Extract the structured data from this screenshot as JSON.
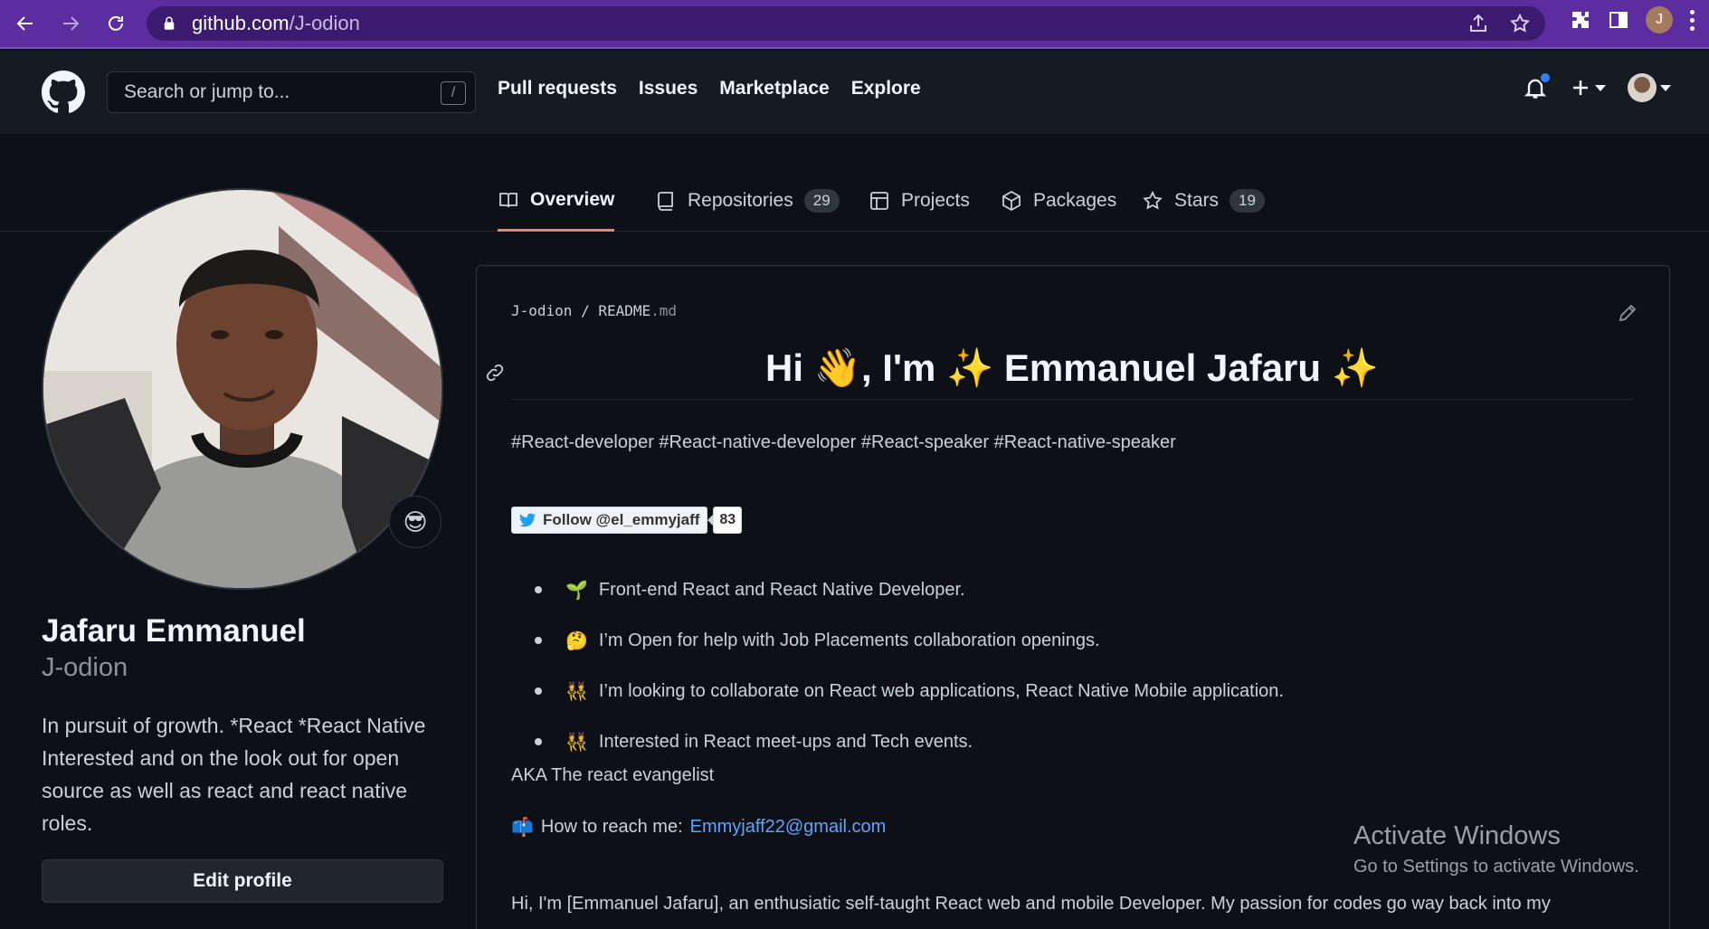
{
  "browser": {
    "url_host": "github.com",
    "url_path": "/J-odion",
    "profile_initial": "J"
  },
  "header": {
    "search_placeholder": "Search or jump to...",
    "search_shortcut": "/",
    "nav": [
      "Pull requests",
      "Issues",
      "Marketplace",
      "Explore"
    ]
  },
  "tabs": {
    "overview": "Overview",
    "repositories": "Repositories",
    "repositories_count": "29",
    "projects": "Projects",
    "packages": "Packages",
    "stars": "Stars",
    "stars_count": "19"
  },
  "profile": {
    "status_emoji": "😎",
    "name": "Jafaru Emmanuel",
    "login": "J-odion",
    "bio": "In pursuit of growth. *React *React Native Interested and on the look out for open source as well as react and react native roles.",
    "edit_button": "Edit profile"
  },
  "readme": {
    "owner": "J-odion",
    "separator": "/",
    "file_name": "README",
    "file_ext": ".md",
    "heading": "Hi 👋, I'm ✨ Emmanuel Jafaru ✨",
    "tags": "#React-developer #React-native-developer #React-speaker #React-native-speaker",
    "twitter_follow": "Follow @el_emmyjaff",
    "twitter_count": "83",
    "bullets": [
      {
        "emoji": "🌱",
        "text": "Front-end React and React Native Developer."
      },
      {
        "emoji": "🤔",
        "text": "I’m Open for help with Job Placements collaboration openings."
      },
      {
        "emoji": "👯",
        "text": "I’m looking to collaborate on React web applications, React Native Mobile application."
      },
      {
        "emoji": "👯",
        "text": "Interested in React meet-ups and Tech events."
      }
    ],
    "aka": "AKA The react evangelist",
    "reach_emoji": "📫",
    "reach_label": "How to reach me:",
    "email": "Emmyjaff22@gmail.com",
    "intro": "Hi, I'm [Emmanuel Jafaru], an enthusiatic self-taught React web and mobile Developer. My passion for codes go way back into my"
  },
  "watermark": {
    "title": "Activate Windows",
    "subtitle": "Go to Settings to activate Windows."
  },
  "colors": {
    "chrome": "#5b2d9e",
    "page_bg": "#0d1117",
    "header_bg": "#161b22",
    "tab_underline": "#f78166",
    "link": "#58a6ff"
  }
}
